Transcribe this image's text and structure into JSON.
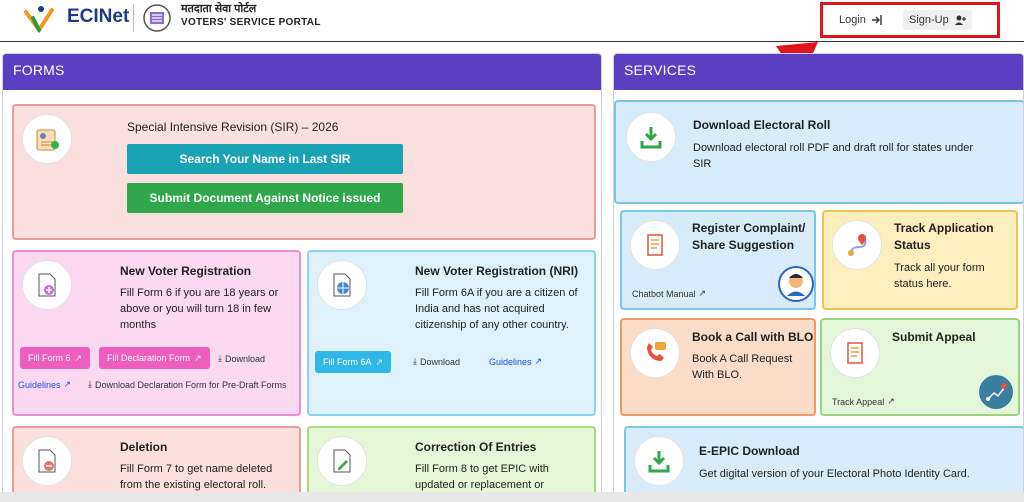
{
  "header": {
    "logo_text": "ECINet",
    "portal_title_hindi": "मतदाता सेवा पोर्टल",
    "portal_title_english": "VOTERS' SERVICE PORTAL",
    "login_label": "Login",
    "signup_label": "Sign-Up"
  },
  "forms": {
    "heading": "FORMS",
    "sir": {
      "title": "Special Intensive Revision (SIR) – 2026",
      "search_button": "Search Your Name in Last SIR",
      "submit_button": "Submit Document Against Notice issued"
    },
    "new_voter": {
      "title": "New Voter Registration",
      "desc": "Fill Form 6 if you are 18 years or above or you will turn 18 in few months",
      "fill_form_6": "Fill Form 6",
      "fill_declaration": "Fill Declaration Form",
      "download": "Download",
      "guidelines": "Guidelines",
      "download_declaration": "Download Declaration Form for Pre-Draft Forms"
    },
    "new_voter_nri": {
      "title": "New Voter Registration (NRI)",
      "desc": "Fill Form 6A if you are a citizen of India and has not acquired citizenship of any other country.",
      "fill_form_6a": "Fill Form 6A",
      "download": "Download",
      "guidelines": "Guidelines"
    },
    "deletion": {
      "title": "Deletion",
      "desc": "Fill Form 7 to get name deleted from the existing electoral roll."
    },
    "correction": {
      "title": "Correction Of Entries",
      "desc": "Fill Form 8 to get EPIC with updated or replacement or"
    }
  },
  "services": {
    "heading": "SERVICES",
    "download_roll": {
      "title": "Download Electoral Roll",
      "desc": "Download electoral roll PDF and draft roll for states under SIR"
    },
    "complaint": {
      "title": "Register Complaint/ Share Suggestion",
      "chatbot_manual": "Chatbot Manual"
    },
    "track": {
      "title": "Track Application Status",
      "desc": "Track all your form status here."
    },
    "blo": {
      "title": "Book a Call with BLO",
      "desc": "Book A Call Request With BLO."
    },
    "appeal": {
      "title": "Submit Appeal",
      "track_appeal": "Track Appeal"
    },
    "epic": {
      "title": "E-EPIC Download",
      "desc": "Get digital version of your Electoral Photo Identity Card."
    }
  },
  "colors": {
    "panel_header": "#5a3fc3",
    "highlight_red": "#e0141c",
    "search_button": "#1aa3b4",
    "submit_button": "#2ea84a",
    "pill_pink": "#ee5fbd",
    "pill_blue": "#2fb7e6"
  }
}
